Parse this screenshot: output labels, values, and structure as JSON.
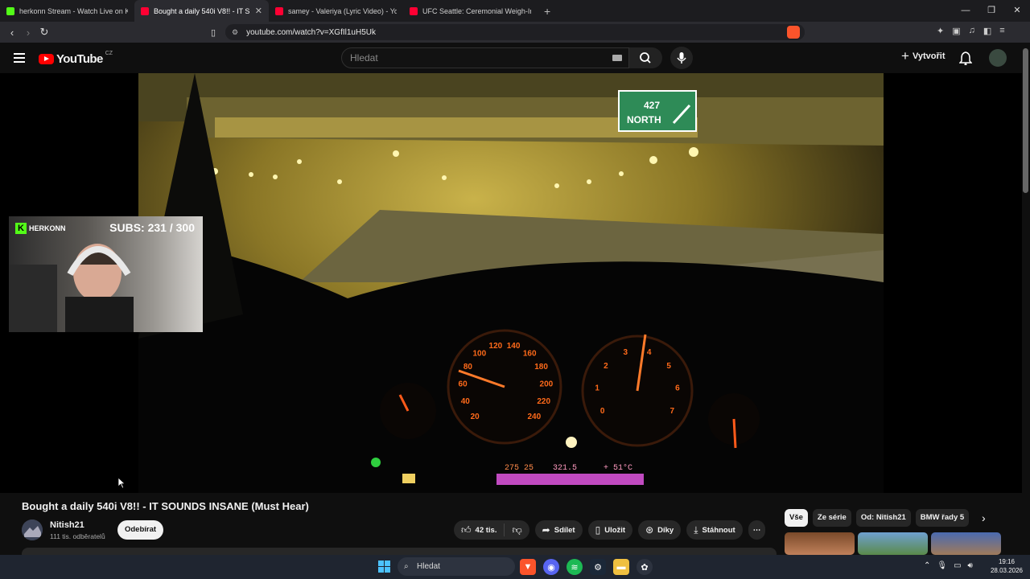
{
  "browser": {
    "tabs": [
      {
        "label": "herkonn Stream - Watch Live on Kick",
        "favicon_color": "#53fc18",
        "active": false
      },
      {
        "label": "Bought a daily 540i V8!! - IT S",
        "favicon_color": "#ff0033",
        "active": true
      },
      {
        "label": "samey - Valeriya (Lyric Video) - YouTu",
        "favicon_color": "#ff0033",
        "active": false
      },
      {
        "label": "UFC Seattle: Ceremonial Weigh-In - Y",
        "favicon_color": "#ff0033",
        "active": false
      }
    ],
    "new_tab": "+",
    "url": "youtube.com/watch?v=XGfIl1uH5Uk",
    "window_controls": [
      "—",
      "❐",
      "✕"
    ]
  },
  "youtube": {
    "logo_text": "YouTube",
    "country_code": "CZ",
    "search_placeholder": "Hledat",
    "create_label": "Vytvořit"
  },
  "stream_overlay": {
    "channel_badge": "HERKONN",
    "subs_text": "SUBS: 231 / 300"
  },
  "video_scene": {
    "road_sign_number": "427",
    "road_sign_text": "NORTH",
    "speedometer_labels": [
      "20",
      "40",
      "60",
      "80",
      "100",
      "120",
      "140",
      "160",
      "180",
      "200",
      "220",
      "240"
    ],
    "tachometer_labels": [
      "0",
      "1",
      "2",
      "3",
      "4",
      "5",
      "6",
      "7"
    ],
    "odometer": "275 25",
    "trip": "321.5",
    "temp": "+ 51°C"
  },
  "video": {
    "title": "Bought a daily 540i V8!! - IT SOUNDS INSANE (Must Hear)",
    "channel_name": "Nitish21",
    "channel_subs": "111 tis. odběratelů",
    "subscribe_label": "Odebírat",
    "like_count": "42 tis.",
    "share_label": "Sdílet",
    "save_label": "Uložit",
    "thanks_label": "Díky",
    "download_label": "Stáhnout",
    "more_label": "⋯"
  },
  "related_chips": [
    {
      "label": "Vše",
      "selected": true
    },
    {
      "label": "Ze série",
      "selected": false
    },
    {
      "label": "Od: Nitish21",
      "selected": false
    },
    {
      "label": "BMW řady 5",
      "selected": false
    }
  ],
  "taskbar": {
    "search_placeholder": "Hledat",
    "time": "19:16",
    "date": "28.03.2026"
  },
  "colors": {
    "yt_red": "#ff0000",
    "kick_green": "#53fc18",
    "dash_orange": "#ff6a1a"
  }
}
